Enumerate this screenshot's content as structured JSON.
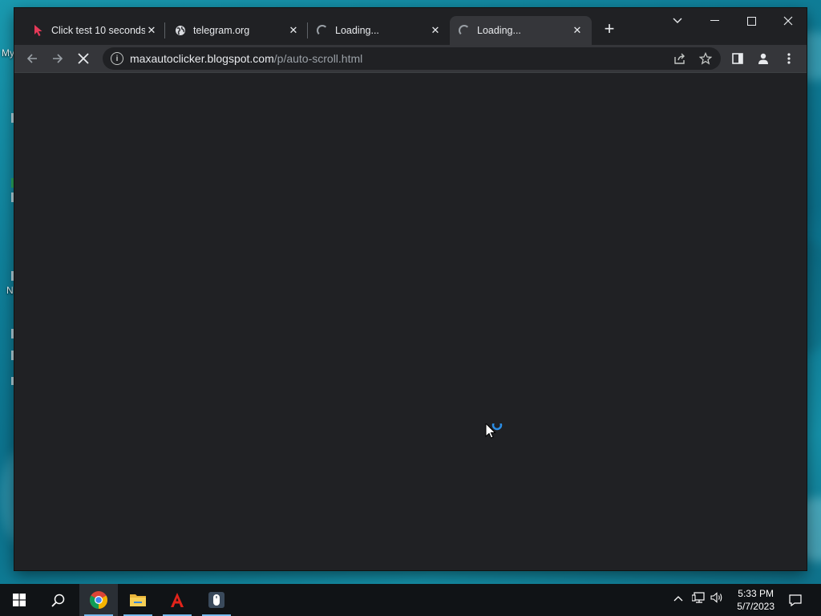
{
  "desktop": {
    "fragments": [
      "My",
      "N"
    ]
  },
  "browser": {
    "tabs": [
      {
        "title": "Click test 10 seconds",
        "favicon": "cursor-arrow-icon",
        "state": "loaded"
      },
      {
        "title": "telegram.org",
        "favicon": "globe-icon",
        "state": "loaded"
      },
      {
        "title": "Loading...",
        "favicon": "loading-spinner-icon",
        "state": "loading"
      },
      {
        "title": "Loading...",
        "favicon": "loading-spinner-icon",
        "state": "loading",
        "active": true
      }
    ],
    "new_tab_symbol": "+",
    "address_bar": {
      "host": "maxautoclicker.blogspot.com",
      "path": "/p/auto-scroll.html"
    },
    "accent": "#8ab4f8"
  },
  "taskbar": {
    "apps": [
      "chrome-icon",
      "file-explorer-icon",
      "acrobat-icon",
      "mouse-app-icon"
    ],
    "clock": {
      "time": "5:33 PM",
      "date": "5/7/2023"
    }
  }
}
